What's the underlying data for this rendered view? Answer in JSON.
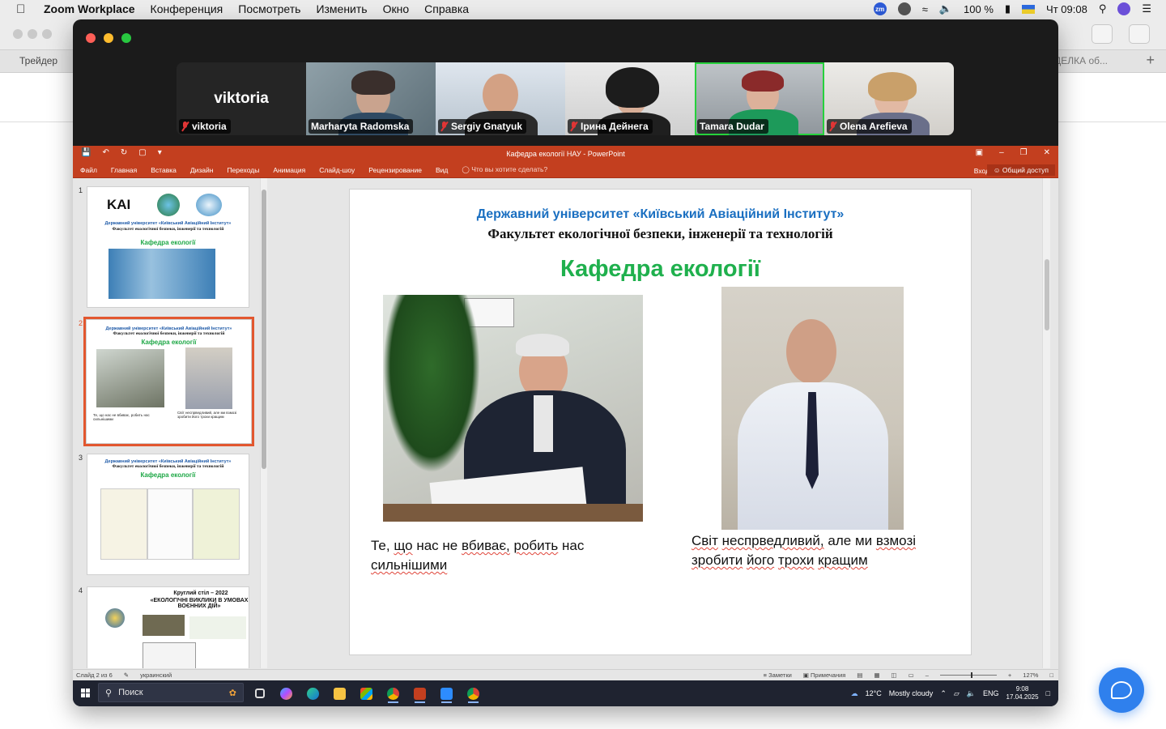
{
  "menubar": {
    "app": "Zoom Workplace",
    "items": [
      "Конференция",
      "Посмотреть",
      "Изменить",
      "Окно",
      "Справка"
    ],
    "zoom_badge": "zm",
    "battery": "100 %",
    "clock": "Чт 09:08"
  },
  "background_browser": {
    "tab_left": "Трейдер",
    "tab_right": "и СДЕЛКА об..."
  },
  "participants": [
    {
      "name": "viktoria",
      "display": "viktoria",
      "video": false,
      "muted": true
    },
    {
      "name": "Marharyta Radomska",
      "video": true,
      "muted": false
    },
    {
      "name": "Sergiy Gnatyuk",
      "video": true,
      "muted": true
    },
    {
      "name": "Ірина Дейнега",
      "video": true,
      "muted": true
    },
    {
      "name": "Tamara Dudar",
      "video": true,
      "muted": false,
      "active_speaker": true
    },
    {
      "name": "Olena Arefieva",
      "video": true,
      "muted": true
    }
  ],
  "powerpoint": {
    "window_title": "Кафедра екології НАУ - PowerPoint",
    "ribbon_tabs": [
      "Файл",
      "Главная",
      "Вставка",
      "Дизайн",
      "Переходы",
      "Анимация",
      "Слайд-шоу",
      "Рецензирование",
      "Вид"
    ],
    "search_hint": "Что вы хотите сделать?",
    "sign_in": "Вход",
    "share": "Общий доступ",
    "thumbnails": [
      {
        "num": "1",
        "logo": "KAI",
        "line1": "Державний університет «Київський Авіаційний Інститут»",
        "line2": "Факультет екологічної безпеки, інженерії та технологій",
        "line3": "Кафедра екології"
      },
      {
        "num": "2",
        "line1": "Державний університет «Київський Авіаційний Інститут»",
        "line2": "Факультет екологічної безпеки, інженерії та технологій",
        "line3": "Кафедра екології",
        "cap1": "Те, що нас не вбиває, робить нас сильнішими",
        "cap2": "Світ неспрведливий, але ми взмозі зробити його трохи кращим"
      },
      {
        "num": "3",
        "line1": "Державний університет «Київський Авіаційний Інститут»",
        "line2": "Факультет екологічної безпеки, інженерії та технологій",
        "line3": "Кафедра екології"
      },
      {
        "num": "4",
        "title1": "Круглий стіл – 2022",
        "title2": "«ЕКОЛОГІЧНІ ВИКЛИКИ В УМОВАХ ВОЄННИХ ДІЙ»"
      }
    ],
    "slide": {
      "university": "Державний університет «Київський Авіаційний Інститут»",
      "faculty": "Факультет екологічної безпеки, інженерії та технологій",
      "department": "Кафедра екології",
      "caption_left_words": [
        "Те,",
        "що",
        "нас",
        "не",
        "вбиває,",
        "робить",
        "нас",
        "сильнішими"
      ],
      "caption_right_words": [
        "Світ",
        "неспрведливий,",
        "але",
        "ми",
        "взмозі",
        "зробити",
        "його",
        "трохи",
        "кращим"
      ]
    },
    "status": {
      "slide_of": "Слайд 2 из 6",
      "language": "украинский",
      "notes": "Заметки",
      "comments": "Примечания",
      "zoom": "127%"
    }
  },
  "taskbar": {
    "search": "Поиск",
    "weather_temp": "12°C",
    "weather_text": "Mostly cloudy",
    "lang": "ENG",
    "time": "9:08",
    "date": "17.04.2025"
  },
  "colors": {
    "ppt_accent": "#c33f1f",
    "slide_blue": "#1a6fc1",
    "slide_green": "#1fb04d",
    "active_speaker": "#26d13c",
    "chat_bubble": "#2f80ed"
  }
}
